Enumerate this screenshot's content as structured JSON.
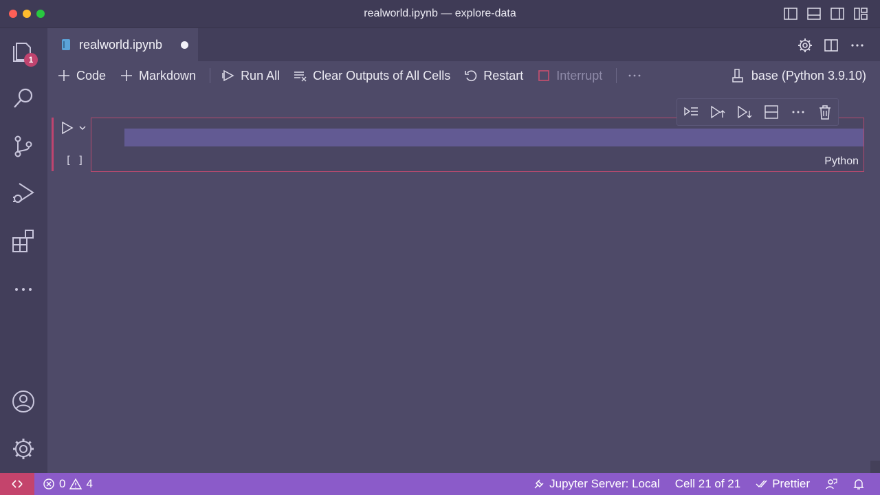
{
  "window": {
    "title": "realworld.ipynb — explore-data"
  },
  "activity_bar": {
    "explorer_badge": "1"
  },
  "tabs": [
    {
      "label": "realworld.ipynb",
      "dirty": true
    }
  ],
  "toolbar": {
    "code_label": "Code",
    "markdown_label": "Markdown",
    "run_all_label": "Run All",
    "clear_outputs_label": "Clear Outputs of All Cells",
    "restart_label": "Restart",
    "interrupt_label": "Interrupt",
    "kernel_label": "base (Python 3.9.10)"
  },
  "cell": {
    "execution_count": "[ ]",
    "language": "Python"
  },
  "status_bar": {
    "errors": "0",
    "warnings": "4",
    "jupyter_server": "Jupyter Server: Local",
    "cell_position": "Cell 21 of 21",
    "prettier": "Prettier"
  },
  "colors": {
    "accent_status": "#8b5bc9",
    "remote": "#c4446c",
    "badge": "#c0446f",
    "background": "#4e4a68"
  }
}
